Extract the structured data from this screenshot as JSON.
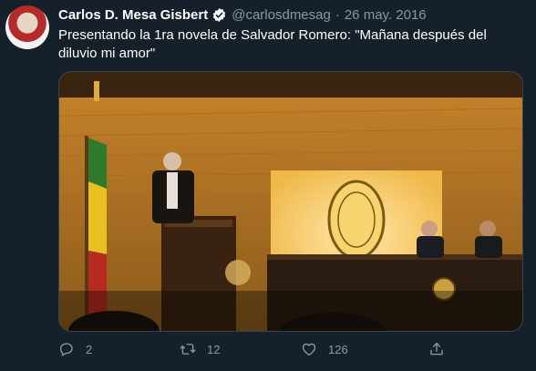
{
  "tweet": {
    "author_name": "Carlos D. Mesa Gisbert",
    "handle": "@carlosdmesag",
    "separator": "·",
    "date": "26 may. 2016",
    "text": "Presentando la 1ra novela de Salvador Romero: \"Mañana después del diluvio mi amor\"",
    "verified": true
  },
  "actions": {
    "reply_count": "2",
    "retweet_count": "12",
    "like_count": "126"
  },
  "icons": {
    "avatar": "profile-photo",
    "verified": "verified-badge-icon",
    "reply": "reply-icon",
    "retweet": "retweet-icon",
    "like": "heart-icon",
    "share": "share-icon"
  },
  "colors": {
    "background": "#15202b",
    "secondary_text": "#8899a6",
    "verified": "#ffffff",
    "border": "#38444d"
  }
}
